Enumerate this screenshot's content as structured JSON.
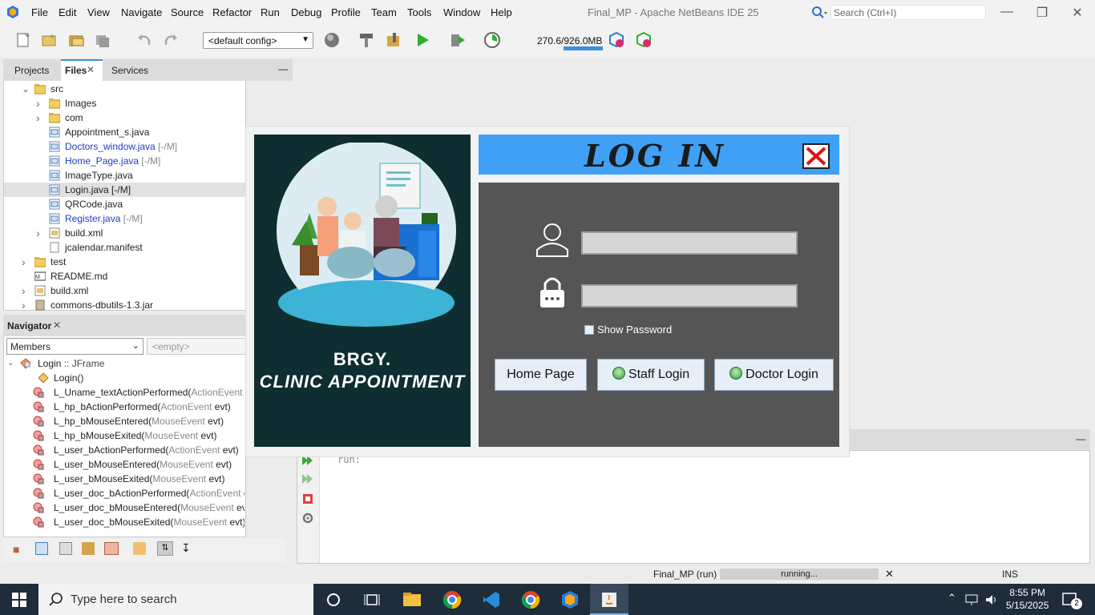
{
  "menubar": {
    "items": [
      "File",
      "Edit",
      "View",
      "Navigate",
      "Source",
      "Refactor",
      "Run",
      "Debug",
      "Profile",
      "Team",
      "Tools",
      "Window",
      "Help"
    ],
    "window_title": "Final_MP - Apache NetBeans IDE 25",
    "search_placeholder": "Search (Ctrl+I)"
  },
  "toolbar": {
    "config": "<default config>",
    "memory": "270.6/926.0MB",
    "memory_fraction": 0.29
  },
  "projects": {
    "tabs": [
      "Projects",
      "Files",
      "Services"
    ],
    "active_tab": "Files",
    "tree": [
      {
        "label": "src",
        "suffix": "",
        "style": "normal"
      },
      {
        "label": "Images",
        "suffix": "",
        "style": "normal"
      },
      {
        "label": "com",
        "suffix": "",
        "style": "normal"
      },
      {
        "label": "Appointment_s.java",
        "suffix": "",
        "style": "normal"
      },
      {
        "label": "Doctors_window.java",
        "suffix": " [-/M]",
        "style": "modified"
      },
      {
        "label": "Home_Page.java",
        "suffix": " [-/M]",
        "style": "modified"
      },
      {
        "label": "ImageType.java",
        "suffix": "",
        "style": "normal"
      },
      {
        "label": "Login.java [-/M]",
        "suffix": "",
        "style": "selected"
      },
      {
        "label": "QRCode.java",
        "suffix": "",
        "style": "normal"
      },
      {
        "label": "Register.java",
        "suffix": " [-/M]",
        "style": "modified"
      },
      {
        "label": "build.xml",
        "suffix": "",
        "style": "normal"
      },
      {
        "label": "jcalendar.manifest",
        "suffix": "",
        "style": "normal"
      },
      {
        "label": "test",
        "suffix": "",
        "style": "normal"
      },
      {
        "label": "README.md",
        "suffix": "",
        "style": "normal"
      },
      {
        "label": "build.xml",
        "suffix": "",
        "style": "normal"
      },
      {
        "label": "commons-dbutils-1.3.jar",
        "suffix": "",
        "style": "normal"
      }
    ]
  },
  "navigator": {
    "title": "Navigator",
    "filter": "Members",
    "empty": "<empty>",
    "root": "Login",
    "root_type": " :: JFrame",
    "members": [
      {
        "name": "Login()",
        "params": "",
        "tail": ""
      },
      {
        "name": "L_Uname_textActionPerformed(",
        "params": "ActionEvent",
        "tail": " e"
      },
      {
        "name": "L_hp_bActionPerformed(",
        "params": "ActionEvent",
        "tail": " evt)"
      },
      {
        "name": "L_hp_bMouseEntered(",
        "params": "MouseEvent",
        "tail": " evt)"
      },
      {
        "name": "L_hp_bMouseExited(",
        "params": "MouseEvent",
        "tail": " evt)"
      },
      {
        "name": "L_user_bActionPerformed(",
        "params": "ActionEvent",
        "tail": " evt)"
      },
      {
        "name": "L_user_bMouseEntered(",
        "params": "MouseEvent",
        "tail": " evt)"
      },
      {
        "name": "L_user_bMouseExited(",
        "params": "MouseEvent",
        "tail": " evt)"
      },
      {
        "name": "L_user_doc_bActionPerformed(",
        "params": "ActionEvent",
        "tail": " evt)"
      },
      {
        "name": "L_user_doc_bMouseEntered(",
        "params": "MouseEvent",
        "tail": " evt)"
      },
      {
        "name": "L_user_doc_bMouseExited(",
        "params": "MouseEvent",
        "tail": " evt)"
      }
    ]
  },
  "output": {
    "text": "run:"
  },
  "statusbar": {
    "project": "Final_MP (run)",
    "progress": "running...",
    "mode": "INS"
  },
  "taskbar": {
    "search_placeholder": "Type here to search",
    "time": "8:55 PM",
    "date": "5/15/2025",
    "notifications": "2"
  },
  "login": {
    "brand_line1": "BRGY.",
    "brand_line2": "CLINIC APPOINTMENT",
    "title": "LOG IN",
    "username": "",
    "password": "",
    "show_password": "Show Password",
    "buttons": {
      "home": "Home Page",
      "staff": "Staff Login",
      "doctor": "Doctor Login"
    }
  },
  "colors": {
    "login_header": "#3fa0f5",
    "login_body": "#555555",
    "left_card": "#0e2e31",
    "close_red": "#e01010"
  }
}
